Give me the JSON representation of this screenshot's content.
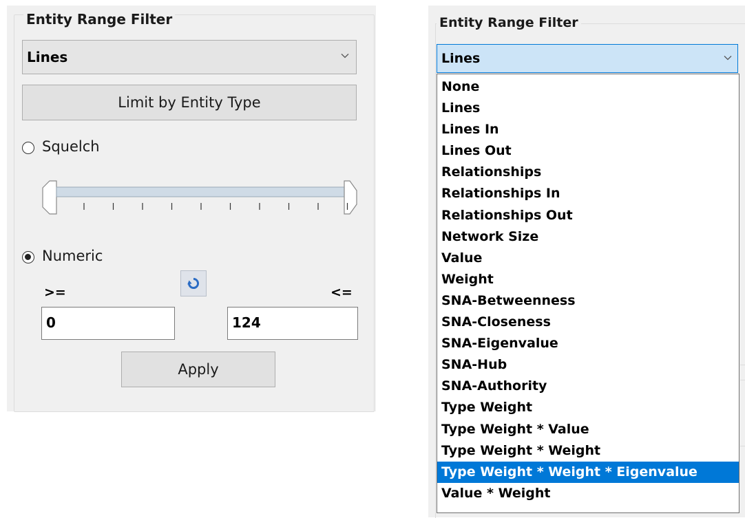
{
  "left_panel": {
    "group_title": "Entity Range Filter",
    "select_value": "Lines",
    "limit_button_label": "Limit by Entity Type",
    "squelch_label": "Squelch",
    "squelch_checked": false,
    "numeric_label": "Numeric",
    "numeric_checked": true,
    "min_operator": ">=",
    "max_operator": "<=",
    "min_value": "0",
    "max_value": "124",
    "apply_label": "Apply",
    "slider_ticks": 10,
    "icons": [
      "chevron-down-icon",
      "refresh-icon"
    ]
  },
  "right_panel": {
    "group_title": "Entity Range Filter",
    "select_value": "Lines",
    "options": [
      "None",
      "Lines",
      "Lines In",
      "Lines Out",
      "Relationships",
      "Relationships In",
      "Relationships Out",
      "Network Size",
      "Value",
      "Weight",
      "SNA-Betweenness",
      "SNA-Closeness",
      "SNA-Eigenvalue",
      "SNA-Hub",
      "SNA-Authority",
      "Type Weight",
      "Type Weight * Value",
      "Type Weight * Weight",
      "Type Weight * Weight * Eigenvalue",
      "Value * Weight"
    ],
    "highlighted_option": "Type Weight * Weight * Eigenvalue"
  },
  "colors": {
    "panel_bg": "#f0f0f0",
    "select_highlight": "#cce4f7",
    "accent": "#0078d7",
    "refresh_icon": "#2b6cc4"
  }
}
